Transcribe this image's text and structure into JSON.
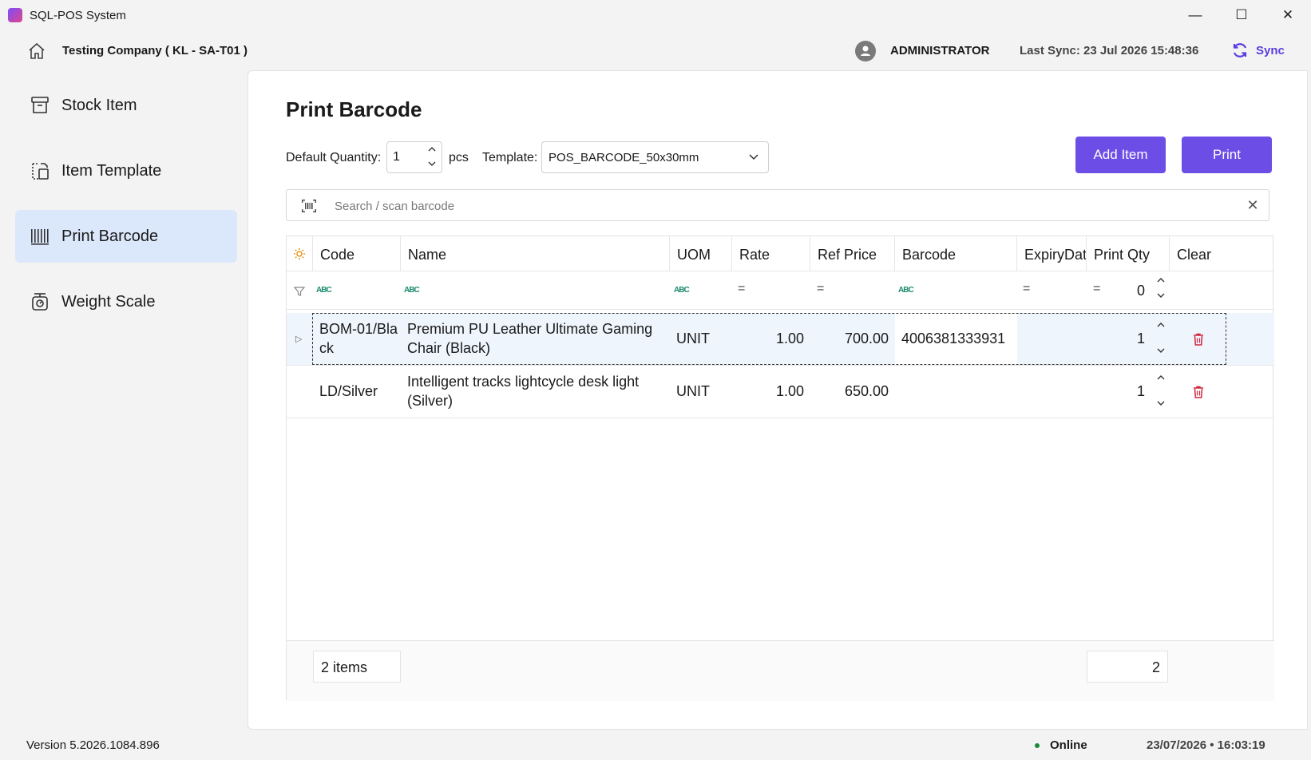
{
  "window": {
    "title": "SQL-POS System",
    "minimize_glyph": "—",
    "maximize_glyph": "☐",
    "close_glyph": "✕"
  },
  "header": {
    "company": "Testing Company ( KL - SA-T01 )",
    "user": "ADMINISTRATOR",
    "last_sync": "Last Sync: 23 Jul 2026 15:48:36",
    "sync_label": "Sync"
  },
  "sidebar": {
    "items": [
      {
        "label": "Stock Item",
        "icon": "archive-box-icon",
        "active": false
      },
      {
        "label": "Item Template",
        "icon": "template-icon",
        "active": false
      },
      {
        "label": "Print Barcode",
        "icon": "barcode-icon",
        "active": true
      },
      {
        "label": "Weight Scale",
        "icon": "scale-icon",
        "active": false
      }
    ]
  },
  "main": {
    "title": "Print Barcode",
    "default_qty_label": "Default Quantity:",
    "default_qty_value": "1",
    "qty_unit": "pcs",
    "template_label": "Template:",
    "template_value": "POS_BARCODE_50x30mm",
    "add_item_label": "Add Item",
    "print_label": "Print",
    "search_placeholder": "Search / scan barcode"
  },
  "grid": {
    "columns": [
      "Code",
      "Name",
      "UOM",
      "Rate",
      "Ref Price",
      "Barcode",
      "ExpiryDat",
      "Print Qty",
      "Clear"
    ],
    "filter": {
      "print_qty": "0",
      "abc_glyph": "ABC",
      "eq_glyph": "="
    },
    "rows": [
      {
        "code": "BOM-01/Black",
        "name": "Premium PU Leather Ultimate Gaming Chair (Black)",
        "uom": "UNIT",
        "rate": "1.00",
        "ref_price": "700.00",
        "barcode": "4006381333931",
        "expiry": "",
        "print_qty": "1",
        "selected": true
      },
      {
        "code": "LD/Silver",
        "name": "Intelligent tracks lightcycle desk light (Silver)",
        "uom": "UNIT",
        "rate": "1.00",
        "ref_price": "650.00",
        "barcode": "",
        "expiry": "",
        "print_qty": "1",
        "selected": false
      }
    ],
    "footer": {
      "item_count": "2 items",
      "qty_total": "2"
    }
  },
  "status": {
    "version": "Version 5.2026.1084.896",
    "online": "Online",
    "datetime": "23/07/2026  • 16:03:19"
  },
  "colors": {
    "accent": "#6c4ee6",
    "sync": "#5b3de0",
    "active_nav": "#dbe8fb",
    "trash": "#d0243c",
    "online": "#1a8a3a"
  }
}
